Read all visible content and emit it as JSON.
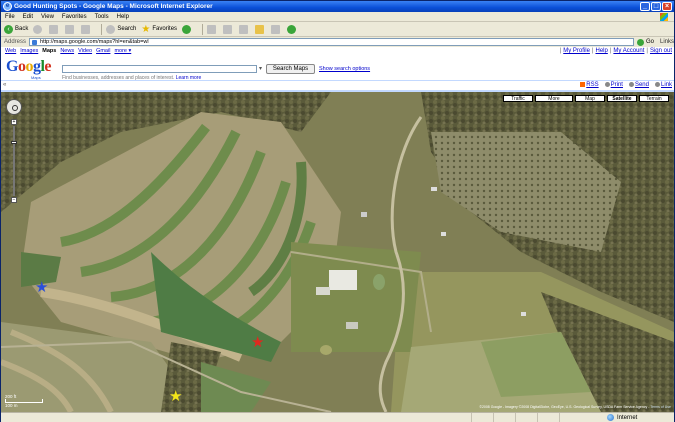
{
  "window": {
    "title": "Good Hunting Spots - Google Maps - Microsoft Internet Explorer"
  },
  "menu": [
    "File",
    "Edit",
    "View",
    "Favorites",
    "Tools",
    "Help"
  ],
  "toolbar": {
    "back_label": "Back",
    "search_label": "Search",
    "favorites_label": "Favorites"
  },
  "address": {
    "label": "Address",
    "url": "http://maps.google.com/maps?hl=en&tab=wl",
    "go_label": "Go",
    "links_label": "Links"
  },
  "google_bar": {
    "links": [
      "Web",
      "Images",
      "Maps",
      "News",
      "Video",
      "Gmail",
      "more ▾"
    ],
    "current": "Maps",
    "user_links": [
      "My Profile",
      "Help",
      "My Account",
      "Sign out"
    ]
  },
  "logo": {
    "letters": [
      "G",
      "o",
      "o",
      "g",
      "l",
      "e"
    ],
    "sub": "Maps"
  },
  "search": {
    "value": "",
    "button_label": "Search Maps",
    "show_options": "Show search options",
    "hint": "Find businesses, addresses and places of interest.",
    "learn_more": "Learn more"
  },
  "page_tools": {
    "rss": "RSS",
    "print": "Print",
    "send": "Send",
    "link": "Link"
  },
  "map": {
    "type_buttons": [
      "Traffic",
      "More",
      "Map",
      "Satellite",
      "Terrain"
    ],
    "active_type": "Satellite",
    "scale_label": "200 ft",
    "scale_label_2": "100 m",
    "copyright": "©2008 Google - Imagery ©2008 DigitalGlobe, GeoEye, U.S. Geological Survey, USDA Farm Service Agency -",
    "terms": "Terms of Use",
    "markers": [
      {
        "name": "blue-star",
        "color": "#2b4fd8"
      },
      {
        "name": "red-star",
        "color": "#e0281f"
      },
      {
        "name": "yellow-star",
        "color": "#f2e51a"
      }
    ]
  },
  "status": {
    "zone": "Internet"
  }
}
